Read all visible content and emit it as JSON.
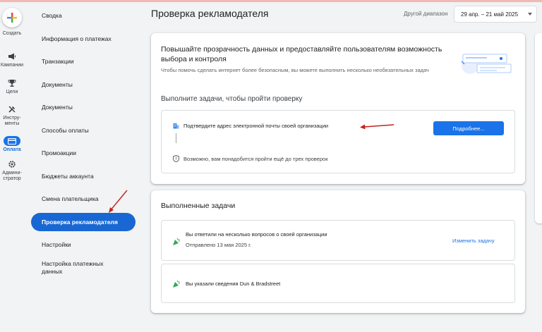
{
  "rail": {
    "create": "Создать",
    "items": [
      {
        "label": "Кампании",
        "icon": "megaphone-icon"
      },
      {
        "label": "Цели",
        "icon": "trophy-icon"
      },
      {
        "label": "Инстру-\nменты",
        "icon": "tools-icon"
      },
      {
        "label": "Оплата",
        "icon": "billing-icon",
        "active": true
      },
      {
        "label": "Админи-\nстратор",
        "icon": "gear-icon"
      }
    ]
  },
  "sidebar": {
    "items": [
      {
        "label": "Сводка"
      },
      {
        "label": "Информация о платежах"
      },
      {
        "label": "Транзакции"
      },
      {
        "label": "Документы"
      },
      {
        "label": "Документы"
      },
      {
        "label": "Способы оплаты"
      },
      {
        "label": "Промоакции"
      },
      {
        "label": "Бюджеты аккаунта"
      },
      {
        "label": "Смена плательщика"
      },
      {
        "label": "Проверка рекламодателя",
        "active": true
      },
      {
        "label": "Настройки"
      },
      {
        "label": "Настройка платежных данных"
      }
    ]
  },
  "header": {
    "title": "Проверка рекламодателя",
    "range_label": "Другой диапазон",
    "range_value": "29 апр. – 21 май 2025"
  },
  "verification": {
    "headline": "Повышайте прозрачность данных и предоставляйте пользователям возможность выбора и контроля",
    "subtext": "Чтобы помочь сделать интернет более безопасным, вы можете выполнить несколько необязательных задач",
    "section_title": "Выполните задачи, чтобы пройти проверку",
    "task": "Подтвердите адрес электронной почты своей организации",
    "task_button": "Подробнее...",
    "note": "Возможно, вам понадобится пройти ещё до трех проверок"
  },
  "completed": {
    "title": "Выполненные задачи",
    "items": [
      {
        "text": "Вы ответили на несколько вопросов о своей организации",
        "sub": "Отправлено 13 мая 2025 г.",
        "action": "Изменить задачу"
      },
      {
        "text": "Вы указали сведения Dun & Bradstreet"
      }
    ]
  },
  "colors": {
    "accent": "#1a73e8",
    "active_nav": "#1967d2",
    "annotation_arrow": "#c5221f"
  }
}
